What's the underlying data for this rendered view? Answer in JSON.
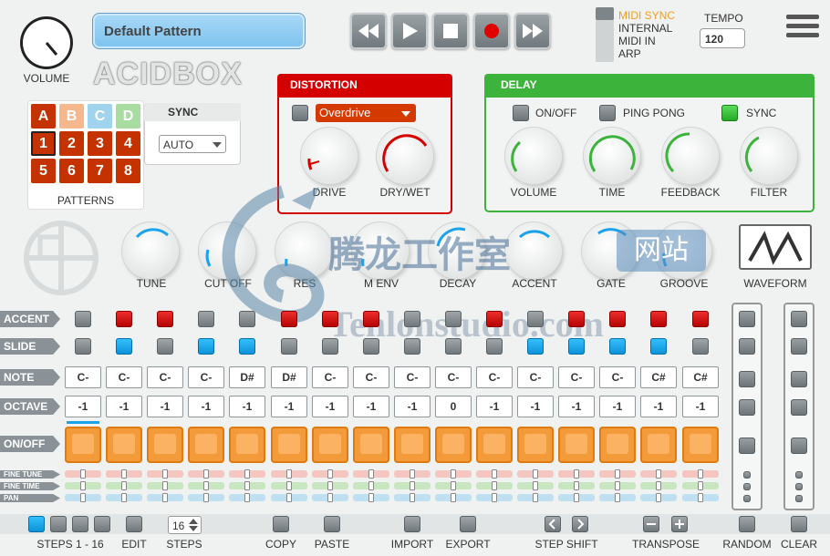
{
  "header": {
    "volume_label": "VOLUME",
    "pattern_name": "Default Pattern",
    "logo_text": "ACIDBOX",
    "sync_modes": [
      "MIDI SYNC",
      "INTERNAL",
      "MIDI IN",
      "ARP"
    ],
    "tempo_label": "TEMPO",
    "tempo_value": "120"
  },
  "patterns": {
    "banks": [
      "A",
      "B",
      "C",
      "D"
    ],
    "slots": [
      "1",
      "2",
      "3",
      "4",
      "5",
      "6",
      "7",
      "8"
    ],
    "label": "PATTERNS",
    "sync_label": "SYNC",
    "sync_value": "AUTO"
  },
  "distortion": {
    "title": "DISTORTION",
    "type": "Overdrive",
    "knobs": [
      "DRIVE",
      "DRY/WET"
    ]
  },
  "delay": {
    "title": "DELAY",
    "toggles": [
      "ON/OFF",
      "PING PONG",
      "SYNC"
    ],
    "knobs": [
      "VOLUME",
      "TIME",
      "FEEDBACK",
      "FILTER"
    ]
  },
  "synth": {
    "knobs": [
      "TUNE",
      "CUT OFF",
      "RES",
      "M ENV",
      "DECAY",
      "ACCENT",
      "GATE",
      "GROOVE"
    ],
    "waveform_label": "WAVEFORM"
  },
  "watermark": {
    "cn_text": "腾龙工作室",
    "cn_badge": "网站",
    "en_text": "Tenlonstudio.com"
  },
  "rows": {
    "accent": "ACCENT",
    "slide": "SLIDE",
    "note": "NOTE",
    "octave": "OCTAVE",
    "onoff": "ON/OFF",
    "fine_tune": "FINE TUNE",
    "fine_time": "FINE TIME",
    "pan": "PAN"
  },
  "sequence": {
    "accent": [
      0,
      1,
      1,
      0,
      0,
      1,
      1,
      1,
      0,
      0,
      1,
      0,
      1,
      1,
      1,
      1
    ],
    "slide": [
      0,
      1,
      0,
      1,
      1,
      0,
      0,
      0,
      0,
      0,
      0,
      1,
      1,
      1,
      1,
      0
    ],
    "notes": [
      "C-",
      "C-",
      "C-",
      "C-",
      "D#",
      "D#",
      "C-",
      "C-",
      "C-",
      "C-",
      "C-",
      "C-",
      "C-",
      "C-",
      "C#",
      "C#"
    ],
    "octaves": [
      "-1",
      "-1",
      "-1",
      "-1",
      "-1",
      "-1",
      "-1",
      "-1",
      "-1",
      "0",
      "-1",
      "-1",
      "-1",
      "-1",
      "-1",
      "-1"
    ]
  },
  "footer": {
    "steps_range": "STEPS 1 - 16",
    "edit": "EDIT",
    "steps_value": "16",
    "steps": "STEPS",
    "copy": "COPY",
    "paste": "PASTE",
    "import": "IMPORT",
    "export": "EXPORT",
    "step_shift": "STEP SHIFT",
    "transpose": "TRANSPOSE",
    "random": "RANDOM",
    "clear": "CLEAR"
  },
  "colors": {
    "accent_red": "#cc0000",
    "slide_blue": "#1aa3ea",
    "distortion_red": "#d40000",
    "delay_green": "#3cb43c",
    "step_orange": "#f39b3b"
  }
}
